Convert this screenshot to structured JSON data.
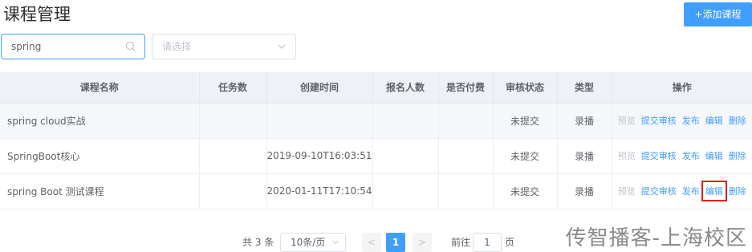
{
  "page": {
    "title": "课程管理",
    "add_button": "+添加课程"
  },
  "filters": {
    "search_value": "spring",
    "status_placeholder": "请选择"
  },
  "table": {
    "headers": [
      "课程名称",
      "任务数",
      "创建时间",
      "报名人数",
      "是否付费",
      "审核状态",
      "类型",
      "操作"
    ],
    "rows": [
      {
        "name": "spring cloud实战",
        "tasks": "",
        "created": "",
        "enrolled": "",
        "paid": "",
        "status": "未提交",
        "type": "录播"
      },
      {
        "name": "SpringBoot核心",
        "tasks": "",
        "created": "2019-09-10T16:03:51",
        "enrolled": "",
        "paid": "",
        "status": "未提交",
        "type": "录播"
      },
      {
        "name": "spring Boot 测试课程",
        "tasks": "",
        "created": "2020-01-11T17:10:54",
        "enrolled": "",
        "paid": "",
        "status": "未提交",
        "type": "录播"
      }
    ],
    "actions": {
      "preview": "预览",
      "submit": "提交审核",
      "publish": "发布",
      "edit": "编辑",
      "delete": "删除"
    }
  },
  "pagination": {
    "total": "共 3 条",
    "page_size": "10条/页",
    "prev": "<",
    "current": "1",
    "next": ">",
    "goto_label": "前往",
    "goto_value": "1",
    "goto_unit": "页"
  },
  "watermark": "传智播客-上海校区",
  "colors": {
    "primary": "#409eff",
    "highlight": "#e0201c",
    "header_bg": "#eef1f6"
  }
}
